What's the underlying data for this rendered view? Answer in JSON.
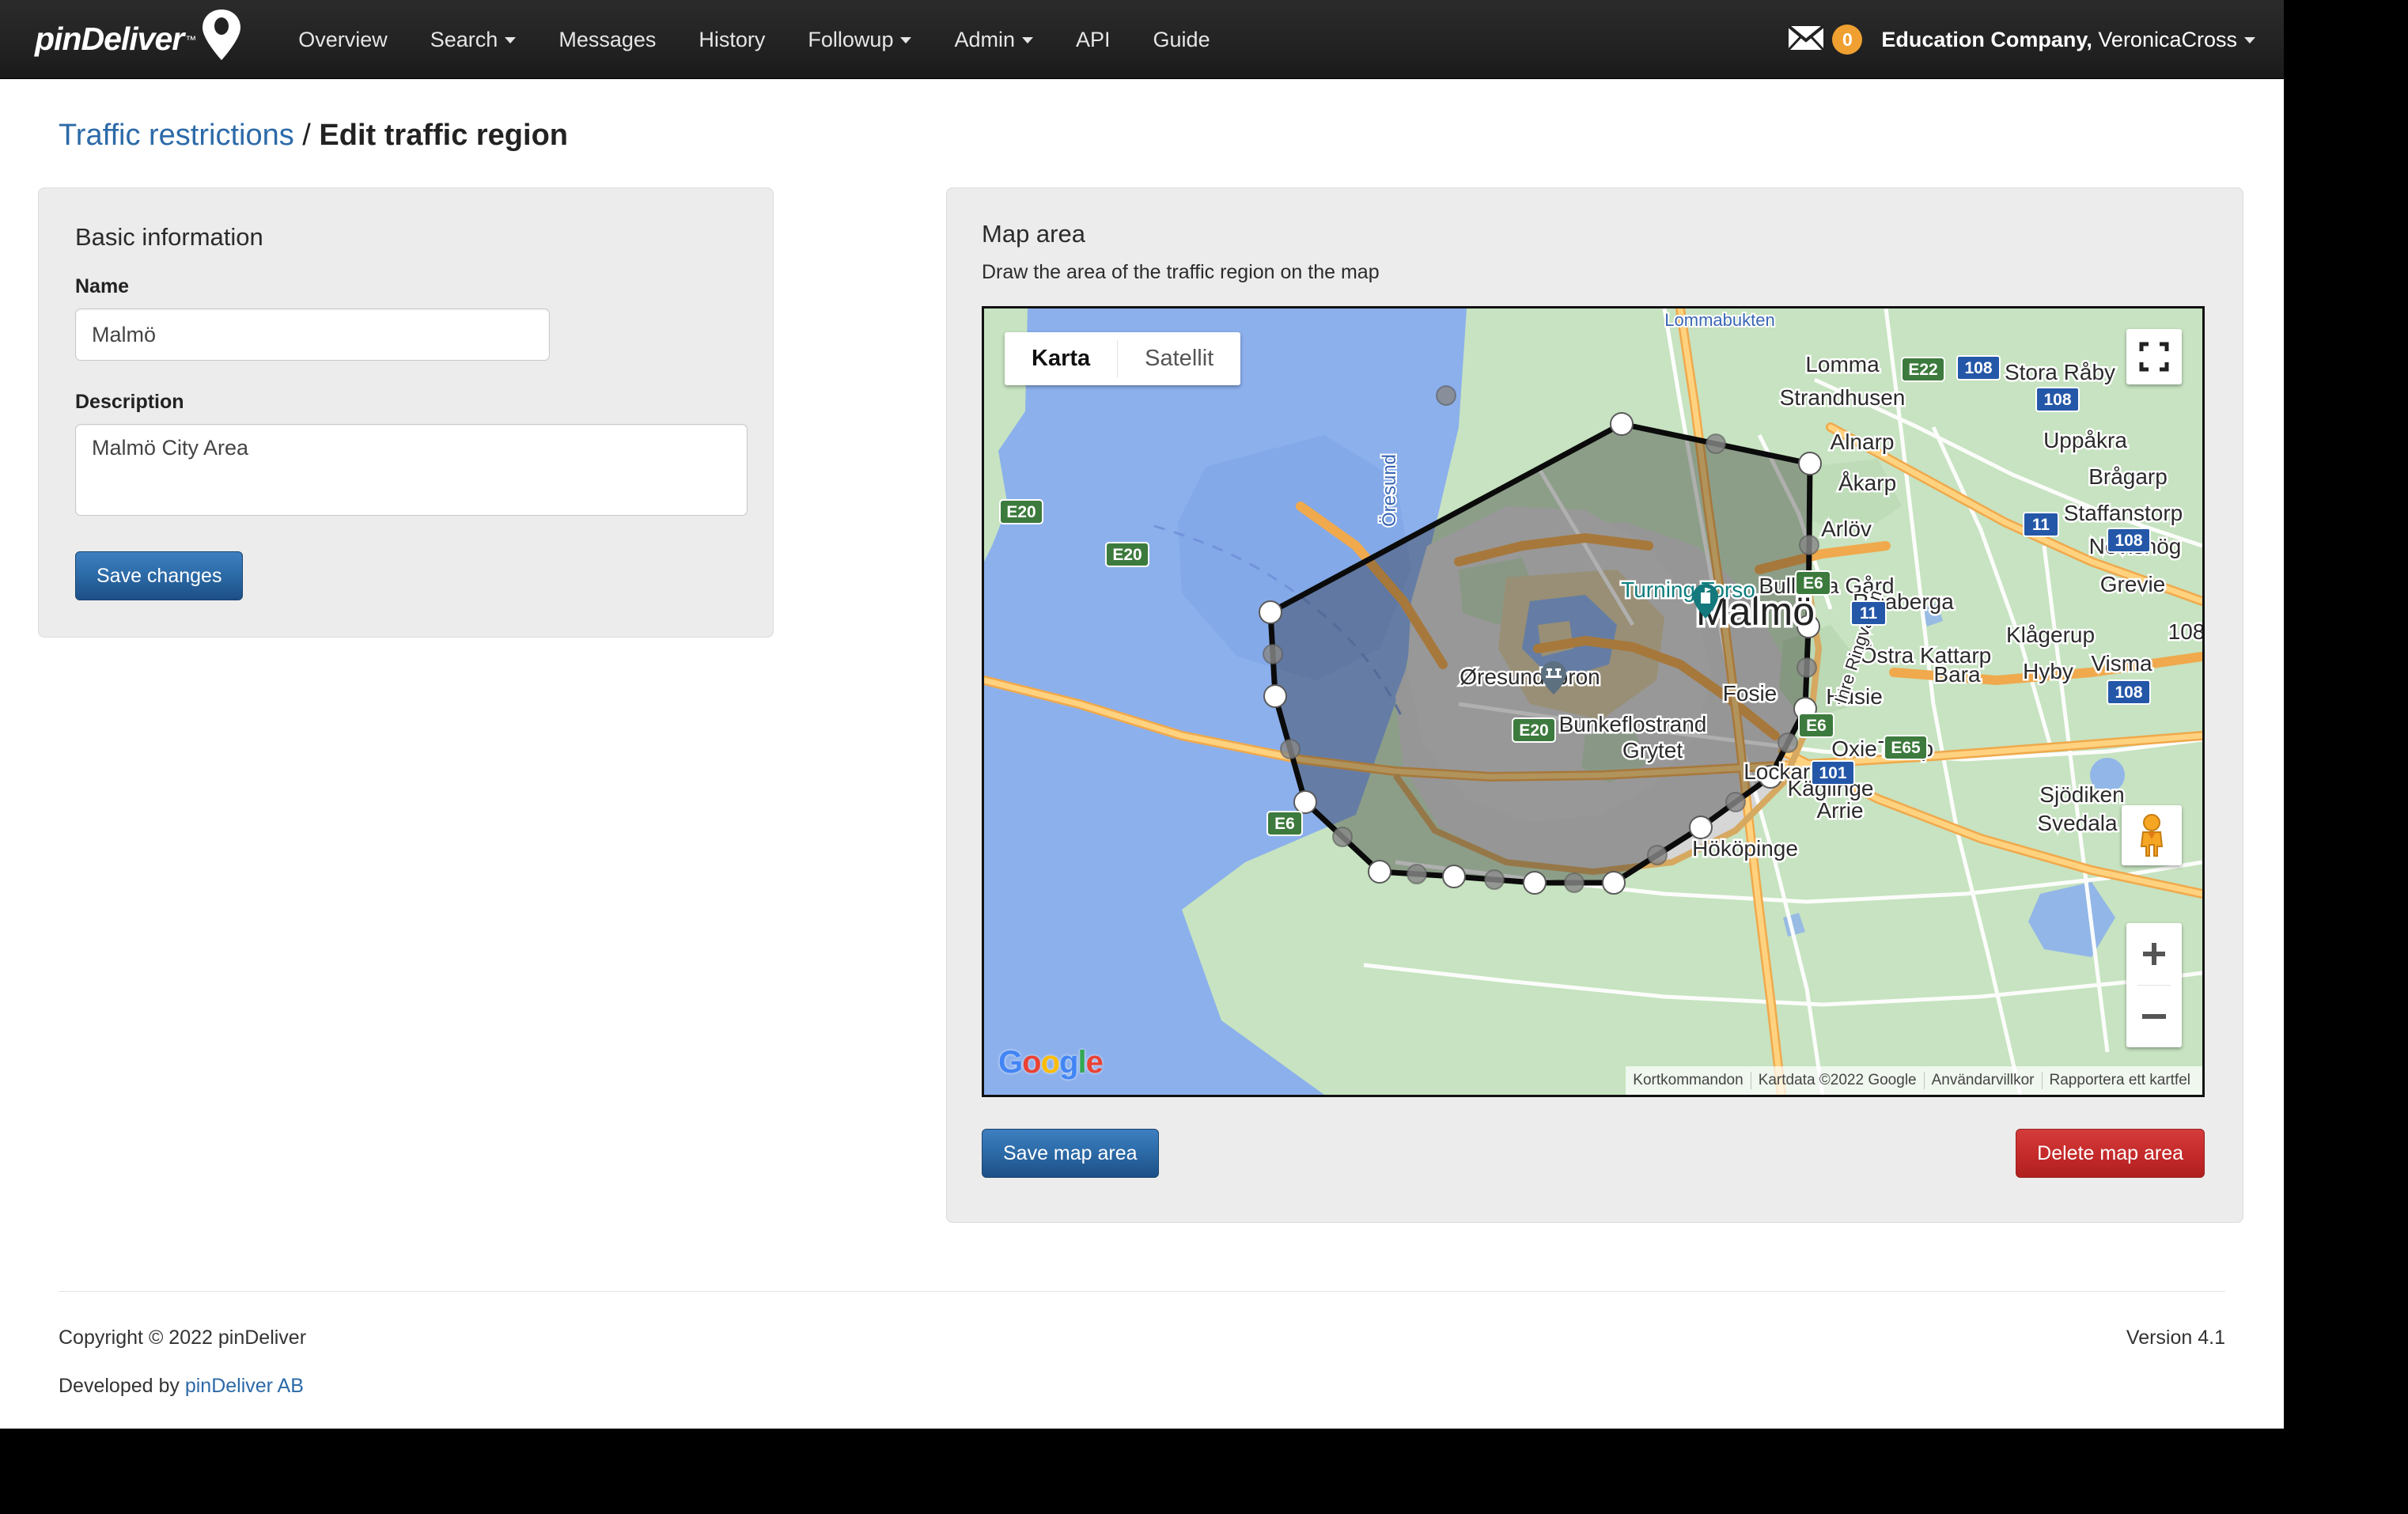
{
  "navbar": {
    "brand": "pinDeliver",
    "brand_tm": "™",
    "brand_pin_icon": "map-pin-icon",
    "links": [
      {
        "label": "Overview",
        "caret": false
      },
      {
        "label": "Search",
        "caret": true
      },
      {
        "label": "Messages",
        "caret": false
      },
      {
        "label": "History",
        "caret": false
      },
      {
        "label": "Followup",
        "caret": true
      },
      {
        "label": "Admin",
        "caret": true
      },
      {
        "label": "API",
        "caret": false
      },
      {
        "label": "Guide",
        "caret": false
      }
    ],
    "mail_icon": "envelope-icon",
    "mail_count": "0",
    "mail_badge_color": "#f0a030",
    "company": "Education Company,",
    "username": " VeronicaCross"
  },
  "page": {
    "breadcrumb_link": "Traffic restrictions",
    "breadcrumb_sep": " / ",
    "breadcrumb_current": "Edit traffic region"
  },
  "basic_info": {
    "title": "Basic information",
    "name_label": "Name",
    "name_value": "Malmö",
    "name_placeholder": "Name",
    "description_label": "Description",
    "description_value": "Malmö City Area",
    "description_placeholder": "Description",
    "save_button": "Save changes"
  },
  "map_panel": {
    "title": "Map area",
    "subtitle": "Draw the area of the traffic region on the map",
    "map_types": [
      {
        "label": "Karta",
        "active": true
      },
      {
        "label": "Satellit",
        "active": false
      }
    ],
    "fullscreen_icon": "fullscreen-icon",
    "pegman_icon": "street-view-pegman-icon",
    "zoom_in_icon": "plus-icon",
    "zoom_out_icon": "minus-icon",
    "google_logo": "google-logo",
    "google_letters": [
      "G",
      "o",
      "o",
      "g",
      "l",
      "e"
    ],
    "attribution": [
      "Kortkommandon",
      "Kartdata ©2022 Google",
      "Användarvillkor",
      "Rapportera ett kartfel"
    ],
    "save_map_button": "Save map area",
    "delete_map_button": "Delete map area",
    "accent_primary": "#2d6ca9",
    "accent_danger": "#c62b2b"
  },
  "map_content": {
    "city_label": "Malmö",
    "water_label": "Öresund",
    "bay_label": "Lommabukten",
    "places": [
      "Lomma",
      "Strandhusen",
      "Alnarp",
      "Åkarp",
      "Arlöv",
      "Uppåkra",
      "Brågarp",
      "Staffanstorp",
      "Nevishög",
      "Grevie",
      "Stora Råby",
      "Klågerup",
      "Hyby",
      "Visma",
      "Bara",
      "Östra Kattarp",
      "Risaberga",
      "Bulltofta Gård",
      "Husie",
      "Fosie",
      "Bunkeflostrand",
      "Grytet",
      "Lockarp",
      "Kåglinge",
      "Oxie",
      "Toarp",
      "Arrie",
      "Sjödiken",
      "Svedala",
      "Hököpinge",
      "Øresundsbron",
      "Turning Torso",
      "Inre Ringvägen"
    ],
    "road_shields": [
      {
        "label": "E20",
        "type": "euro"
      },
      {
        "label": "E22",
        "type": "euro"
      },
      {
        "label": "E6",
        "type": "euro"
      },
      {
        "label": "E65",
        "type": "euro"
      },
      {
        "label": "11",
        "type": "national"
      },
      {
        "label": "101",
        "type": "national"
      },
      {
        "label": "108",
        "type": "national"
      }
    ],
    "poi_markers": [
      "turning-torso-marker",
      "oresundsbron-bridge-marker"
    ],
    "polygon_stroke": "#0b0b0b",
    "polygon_fill": "rgba(20,20,20,0.35)",
    "vertex_fill": "#ffffff",
    "midpoint_fill": "rgba(140,140,140,0.85)"
  },
  "footer": {
    "copyright": "Copyright © 2022 pinDeliver",
    "version": "Version 4.1",
    "developed_prefix": "Developed by ",
    "developed_link": "pinDeliver AB"
  }
}
